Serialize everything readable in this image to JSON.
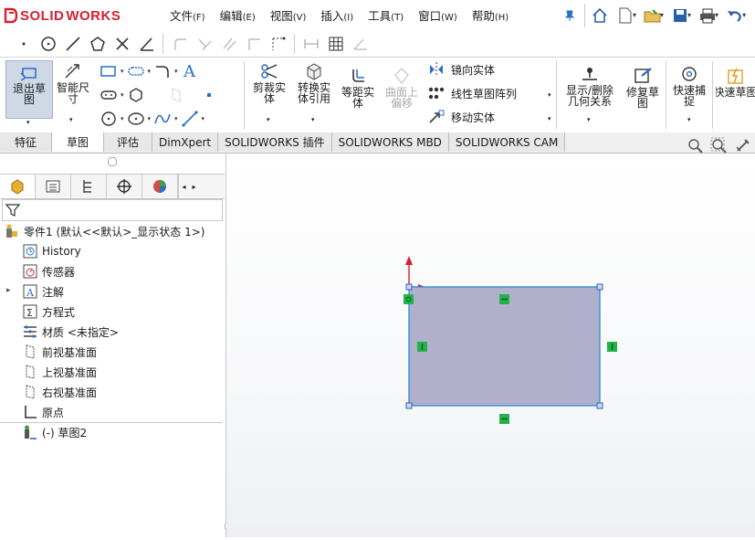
{
  "app": {
    "logo_ds": "DS",
    "logo_solid": "SOLID",
    "logo_works": "WORKS"
  },
  "menu": [
    {
      "label": "文件",
      "key": "(F)"
    },
    {
      "label": "编辑",
      "key": "(E)"
    },
    {
      "label": "视图",
      "key": "(V)"
    },
    {
      "label": "插入",
      "key": "(I)"
    },
    {
      "label": "工具",
      "key": "(T)"
    },
    {
      "label": "窗口",
      "key": "(W)"
    },
    {
      "label": "帮助",
      "key": "(H)"
    }
  ],
  "commands": {
    "exit_sketch": "退出草图",
    "smart_dim": "智能尺寸",
    "trim": "剪裁实体",
    "convert": "转换实体引用",
    "offset": "等距实体",
    "surface_offset": "曲面上偏移",
    "mirror": "镜向实体",
    "linear_pattern": "线性草图阵列",
    "move": "移动实体",
    "show_delete": "显示/删除几何关系",
    "repair": "修复草图",
    "quick_snap": "快速捕捉",
    "quick_sketch": "快速草图"
  },
  "tabs": [
    "特征",
    "草图",
    "评估",
    "DimXpert",
    "SOLIDWORKS 插件",
    "SOLIDWORKS MBD",
    "SOLIDWORKS CAM"
  ],
  "active_tab": "草图",
  "tree": {
    "part": "零件1 (默认<<默认>_显示状态 1>)",
    "items": [
      "History",
      "传感器",
      "注解",
      "方程式",
      "材质 <未指定>",
      "前视基准面",
      "上视基准面",
      "右视基准面",
      "原点",
      "(-) 草图2"
    ]
  },
  "colors": {
    "accent_red": "#d6202f",
    "rect_fill": "#b0b0cc",
    "rect_edge": "#3b8de0",
    "relation_green": "#22b34a"
  }
}
